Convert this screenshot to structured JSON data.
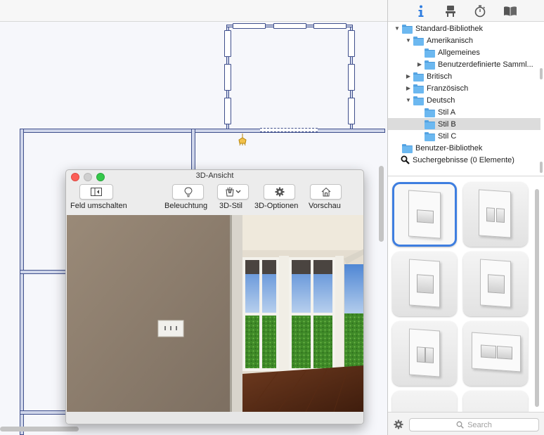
{
  "window3d": {
    "title": "3D-Ansicht",
    "toolbar": [
      {
        "label": "Feld umschalten",
        "icon": "panel-toggle-icon"
      },
      {
        "label": "Beleuchtung",
        "icon": "lightbulb-icon"
      },
      {
        "label": "3D-Stil",
        "icon": "paintbrush-cup-icon"
      },
      {
        "label": "3D-Optionen",
        "icon": "gear-icon"
      },
      {
        "label": "Vorschau",
        "icon": "house-icon"
      }
    ]
  },
  "sidebar": {
    "tabs": [
      {
        "name": "info-icon",
        "active": true
      },
      {
        "name": "chair-icon",
        "active": false
      },
      {
        "name": "stopwatch-icon",
        "active": false
      },
      {
        "name": "book-icon",
        "active": false
      }
    ],
    "tree": [
      {
        "label": "Standard-Bibliothek",
        "level": 0,
        "disclosure": "open"
      },
      {
        "label": "Amerikanisch",
        "level": 1,
        "disclosure": "open"
      },
      {
        "label": "Allgemeines",
        "level": 2,
        "disclosure": "none"
      },
      {
        "label": "Benutzerdefinierte Samml...",
        "level": 2,
        "disclosure": "closed"
      },
      {
        "label": "Britisch",
        "level": 1,
        "disclosure": "closed"
      },
      {
        "label": "Französisch",
        "level": 1,
        "disclosure": "closed"
      },
      {
        "label": "Deutsch",
        "level": 1,
        "disclosure": "open"
      },
      {
        "label": "Stil A",
        "level": 2,
        "disclosure": "none"
      },
      {
        "label": "Stil B",
        "level": 2,
        "disclosure": "none",
        "selected": true
      },
      {
        "label": "Stil C",
        "level": 2,
        "disclosure": "none"
      },
      {
        "label": "Benutzer-Bibliothek",
        "level": 0,
        "disclosure": "none"
      },
      {
        "label": "Suchergebnisse (0 Elemente)",
        "level": 0,
        "disclosure": "none",
        "icon": "magnifier-icon"
      }
    ],
    "search": {
      "placeholder": "Search"
    }
  },
  "colors": {
    "accent": "#3e7ee0",
    "wall": "#3f4f8c",
    "folder": "#6cb8f0"
  }
}
